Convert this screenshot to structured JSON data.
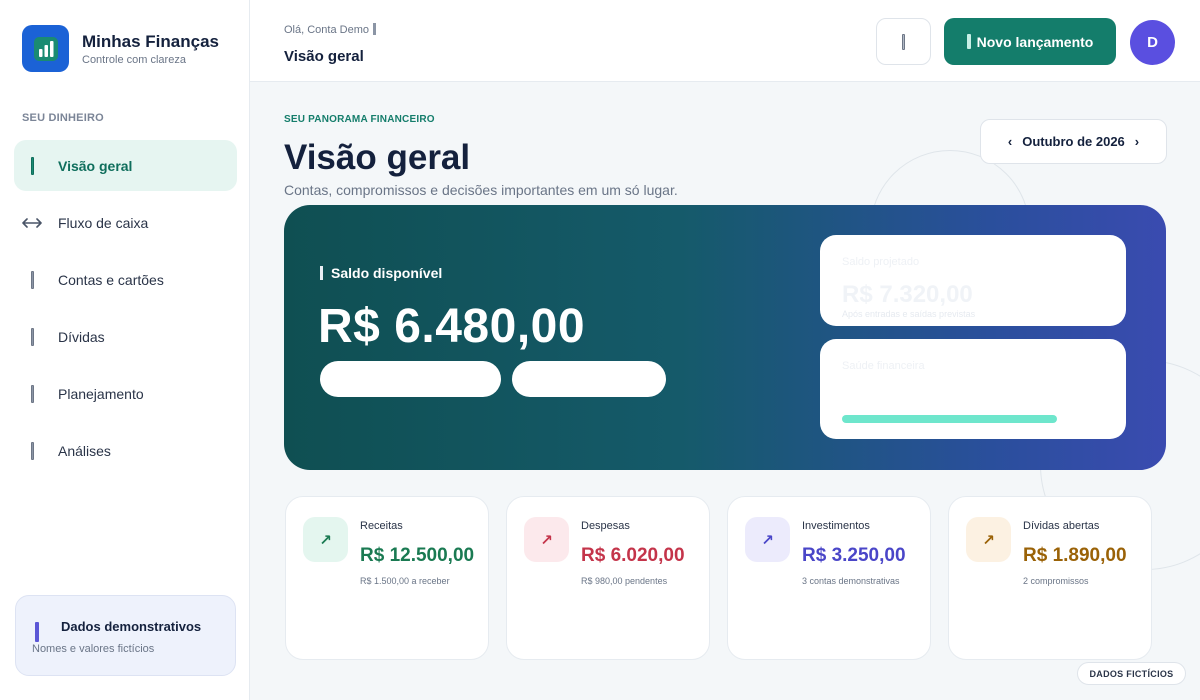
{
  "brand": {
    "name": "Minhas Finanças",
    "tagline": "Controle com clareza",
    "logo_icon": "bar-chart-icon",
    "logo_color": "#1b62d6"
  },
  "sidebar": {
    "section_label": "SEU DINHEIRO",
    "items": [
      {
        "label": "Visão geral",
        "icon": "bar-icon",
        "active": true
      },
      {
        "label": "Fluxo de caixa",
        "icon": "arrows-left-right-icon",
        "active": false
      },
      {
        "label": "Contas e cartões",
        "icon": "bar-icon",
        "active": false
      },
      {
        "label": "Dívidas",
        "icon": "bar-icon",
        "active": false
      },
      {
        "label": "Planejamento",
        "icon": "bar-icon",
        "active": false
      },
      {
        "label": "Análises",
        "icon": "bar-icon",
        "active": false
      }
    ],
    "demo": {
      "title": "Dados demonstrativos",
      "subtitle": "Nomes e valores fictícios"
    }
  },
  "header": {
    "greeting": "Olá, Conta Demo",
    "breadcrumb": "Visão geral",
    "primary_button": "Novo lançamento",
    "avatar_initial": "D",
    "accent": "#147d6b",
    "avatar_color": "#5a4fe0"
  },
  "main": {
    "eyebrow": "SEU PANORAMA FINANCEIRO",
    "title": "Visão geral",
    "subtitle": "Contas, compromissos e decisões importantes em um só lugar.",
    "month": "Outubro de 2026",
    "hero": {
      "label": "Saldo disponível",
      "amount": "R$ 6.480,00",
      "projected_label": "Saldo projetado",
      "projected_amount": "R$ 7.320,00",
      "projected_sub": "Após entradas e saídas previstas",
      "health_label": "Saúde financeira"
    },
    "kpis": [
      {
        "name": "Receitas",
        "value": "R$ 12.500,00",
        "sub": "R$ 1.500,00 a receber",
        "icon": "arrow-up-right-icon",
        "color": "#1a7a52",
        "icon_bg": "#e4f6ef"
      },
      {
        "name": "Despesas",
        "value": "R$ 6.020,00",
        "sub": "R$ 980,00 pendentes",
        "icon": "arrow-up-right-icon",
        "color": "#c4344a",
        "icon_bg": "#fce9ec"
      },
      {
        "name": "Investimentos",
        "value": "R$ 3.250,00",
        "sub": "3 contas demonstrativas",
        "icon": "arrow-up-right-icon",
        "color": "#4a46c8",
        "icon_bg": "#ecebfc"
      },
      {
        "name": "Dívidas abertas",
        "value": "R$ 1.890,00",
        "sub": "2 compromissos",
        "icon": "arrow-up-right-icon",
        "color": "#9a6207",
        "icon_bg": "#fcf1e2"
      }
    ],
    "footer_badge": "DADOS FICTÍCIOS"
  }
}
